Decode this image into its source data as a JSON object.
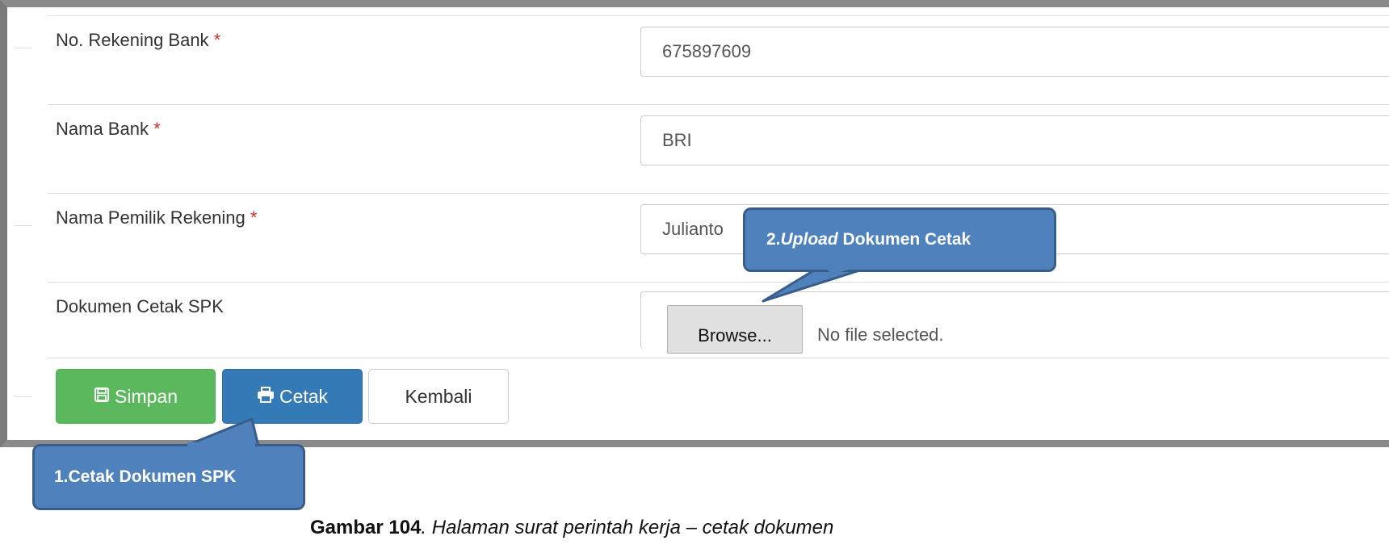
{
  "form": {
    "rekening": {
      "label": "No. Rekening Bank",
      "required_mark": "*",
      "value": "675897609"
    },
    "bank": {
      "label": "Nama Bank",
      "required_mark": "*",
      "value": "BRI"
    },
    "pemilik": {
      "label": "Nama Pemilik Rekening",
      "required_mark": "*",
      "value": "Julianto"
    },
    "dokumen": {
      "label": "Dokumen Cetak SPK",
      "browse_label": "Browse...",
      "file_status": "No file selected."
    }
  },
  "actions": {
    "simpan_label": "Simpan",
    "cetak_label": "Cetak",
    "kembali_label": "Kembali",
    "simpan_icon": "save-icon",
    "cetak_icon": "print-icon"
  },
  "callouts": {
    "upload": {
      "number": "2.",
      "italic": "Upload",
      "text": " Dokumen Cetak"
    },
    "cetak": {
      "text": "1.Cetak Dokumen SPK"
    }
  },
  "caption": {
    "bold": "Gambar 104",
    "italic": ". Halaman surat perintah kerja – cetak dokumen"
  },
  "colors": {
    "required": "#c9302c",
    "success": "#5cb85c",
    "primary": "#337ab7",
    "callout_fill": "#4f81bd",
    "callout_border": "#385d8a"
  }
}
